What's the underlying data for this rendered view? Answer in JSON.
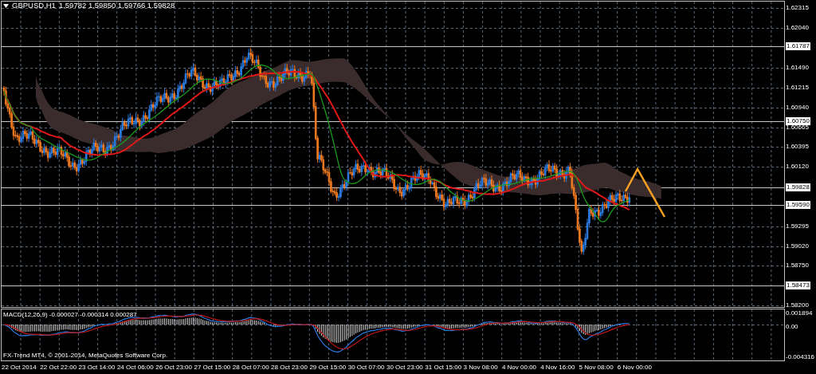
{
  "chart": {
    "symbol": "GBPUSD,H1",
    "quote": "1.59782 1.59850 1.59766 1.59828",
    "price_ticks": [
      "1.62315",
      "1.62040",
      "1.61490",
      "1.61215",
      "1.60940",
      "1.60665",
      "1.60395",
      "1.60120",
      "1.59295",
      "1.59020",
      "1.58750",
      "1.58200"
    ],
    "price_levels": [
      "1.61787",
      "1.60750",
      "1.59828",
      "1.59590",
      "1.58473"
    ],
    "macd": {
      "label": "MACD(12,26,9) -0.000027 -0.000314 0.000287",
      "ticks": [
        "0.001894",
        "0.00",
        "-0.004316"
      ]
    },
    "copyright": "FX-Trend MT4, © 2001-2014, MetaQuotes Software Corp.",
    "time_labels": [
      "22 Oct 2014",
      "22 Oct 22:00",
      "23 Oct 14:00",
      "24 Oct 06:00",
      "26 Oct 23:00",
      "27 Oct 15:00",
      "28 Oct 07:00",
      "28 Oct 23:00",
      "29 Oct 15:00",
      "30 Oct 07:00",
      "30 Oct 23:00",
      "31 Oct 15:00",
      "3 Nov 08:00",
      "4 Nov 00:00",
      "4 Nov 16:00",
      "5 Nov 08:00",
      "6 Nov 00:00"
    ]
  }
}
